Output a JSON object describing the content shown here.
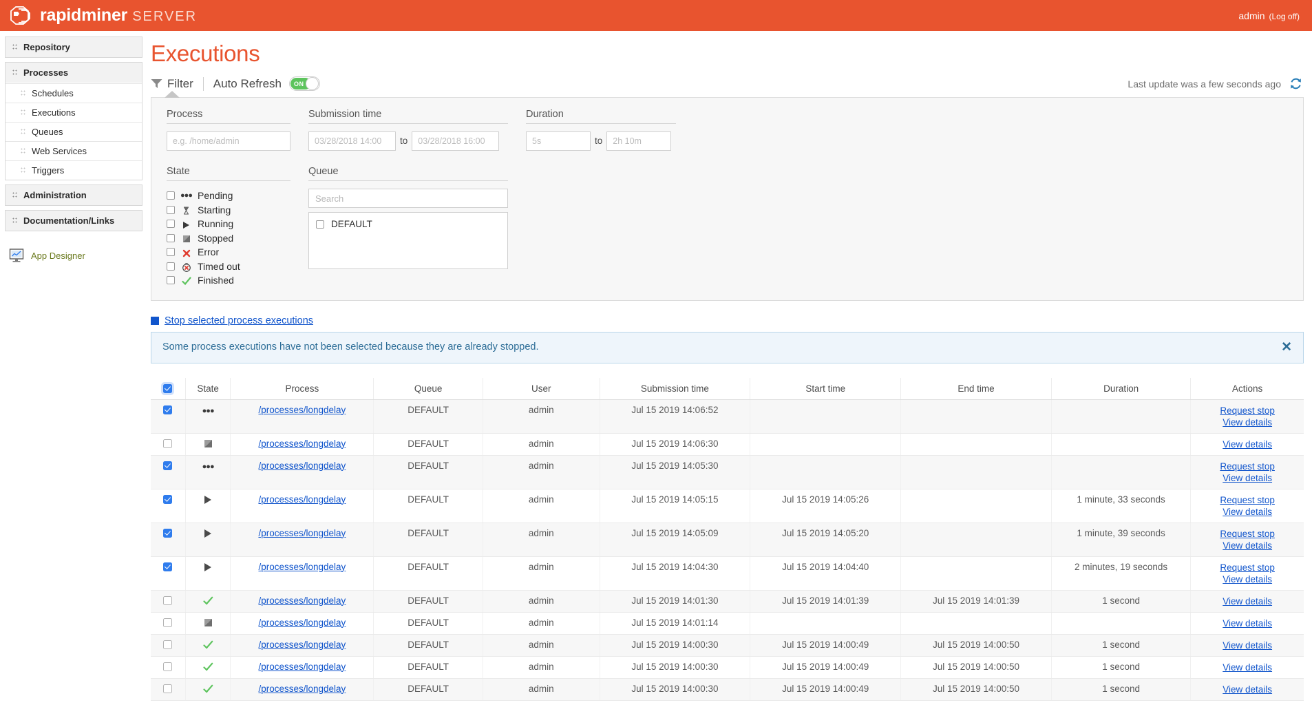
{
  "topbar": {
    "brand": "rapidminer",
    "brand_sub": "SERVER",
    "user": "admin",
    "logoff": "(Log off)",
    "bg_color": "#e8542f"
  },
  "sidebar": {
    "groups": [
      {
        "label": "Repository",
        "items": []
      },
      {
        "label": "Processes",
        "items": [
          "Schedules",
          "Executions",
          "Queues",
          "Web Services",
          "Triggers"
        ]
      },
      {
        "label": "Administration",
        "items": []
      },
      {
        "label": "Documentation/Links",
        "items": []
      }
    ],
    "app_designer": "App Designer"
  },
  "page": {
    "title": "Executions",
    "filter_label": "Filter",
    "auto_refresh_label": "Auto Refresh",
    "toggle_state": "ON",
    "last_update": "Last update was a few seconds ago"
  },
  "filter": {
    "process": {
      "label": "Process",
      "value": "",
      "placeholder": "e.g. /home/admin"
    },
    "submission": {
      "label": "Submission time",
      "from_value": "",
      "from_placeholder": "03/28/2018 14:00",
      "to_word": "to",
      "to_value": "",
      "to_placeholder": "03/28/2018 16:00"
    },
    "duration": {
      "label": "Duration",
      "from_value": "",
      "from_placeholder": "5s",
      "to_word": "to",
      "to_value": "",
      "to_placeholder": "2h 10m"
    },
    "state": {
      "label": "State",
      "options": [
        {
          "label": "Pending",
          "icon": "pending-icon",
          "checked": false
        },
        {
          "label": "Starting",
          "icon": "hourglass-icon",
          "checked": false
        },
        {
          "label": "Running",
          "icon": "play-icon",
          "checked": false
        },
        {
          "label": "Stopped",
          "icon": "stop-icon",
          "checked": false
        },
        {
          "label": "Error",
          "icon": "x-error-icon",
          "checked": false
        },
        {
          "label": "Timed out",
          "icon": "timeout-icon",
          "checked": false
        },
        {
          "label": "Finished",
          "icon": "check-icon",
          "checked": false
        }
      ]
    },
    "queue": {
      "label": "Queue",
      "search_value": "",
      "search_placeholder": "Search",
      "items": [
        {
          "label": "DEFAULT",
          "checked": false
        }
      ]
    }
  },
  "actions": {
    "stop_selected": "Stop selected process executions"
  },
  "alert": {
    "message": "Some process executions have not been selected because they are already stopped.",
    "close": "✕",
    "text_color": "#2b6c96",
    "bg_color": "#eef5fb"
  },
  "table": {
    "headers": [
      "",
      "State",
      "Process",
      "Queue",
      "User",
      "Submission time",
      "Start time",
      "End time",
      "Duration",
      "Actions"
    ],
    "header_checkbox_checked": true,
    "rows": [
      {
        "checked": true,
        "state": "pending",
        "process": "/processes/longdelay",
        "queue": "DEFAULT",
        "user": "admin",
        "submission": "Jul 15 2019 14:06:52",
        "start": "",
        "end": "",
        "duration": "",
        "actions": [
          "Request stop",
          "View details"
        ]
      },
      {
        "checked": false,
        "state": "stopped",
        "process": "/processes/longdelay",
        "queue": "DEFAULT",
        "user": "admin",
        "submission": "Jul 15 2019 14:06:30",
        "start": "",
        "end": "",
        "duration": "",
        "actions": [
          "View details"
        ]
      },
      {
        "checked": true,
        "state": "pending",
        "process": "/processes/longdelay",
        "queue": "DEFAULT",
        "user": "admin",
        "submission": "Jul 15 2019 14:05:30",
        "start": "",
        "end": "",
        "duration": "",
        "actions": [
          "Request stop",
          "View details"
        ]
      },
      {
        "checked": true,
        "state": "running",
        "process": "/processes/longdelay",
        "queue": "DEFAULT",
        "user": "admin",
        "submission": "Jul 15 2019 14:05:15",
        "start": "Jul 15 2019 14:05:26",
        "end": "",
        "duration": "1 minute, 33 seconds",
        "actions": [
          "Request stop",
          "View details"
        ]
      },
      {
        "checked": true,
        "state": "running",
        "process": "/processes/longdelay",
        "queue": "DEFAULT",
        "user": "admin",
        "submission": "Jul 15 2019 14:05:09",
        "start": "Jul 15 2019 14:05:20",
        "end": "",
        "duration": "1 minute, 39 seconds",
        "actions": [
          "Request stop",
          "View details"
        ]
      },
      {
        "checked": true,
        "state": "running",
        "process": "/processes/longdelay",
        "queue": "DEFAULT",
        "user": "admin",
        "submission": "Jul 15 2019 14:04:30",
        "start": "Jul 15 2019 14:04:40",
        "end": "",
        "duration": "2 minutes, 19 seconds",
        "actions": [
          "Request stop",
          "View details"
        ]
      },
      {
        "checked": false,
        "state": "finished",
        "process": "/processes/longdelay",
        "queue": "DEFAULT",
        "user": "admin",
        "submission": "Jul 15 2019 14:01:30",
        "start": "Jul 15 2019 14:01:39",
        "end": "Jul 15 2019 14:01:39",
        "duration": "1 second",
        "actions": [
          "View details"
        ]
      },
      {
        "checked": false,
        "state": "stopped",
        "process": "/processes/longdelay",
        "queue": "DEFAULT",
        "user": "admin",
        "submission": "Jul 15 2019 14:01:14",
        "start": "",
        "end": "",
        "duration": "",
        "actions": [
          "View details"
        ]
      },
      {
        "checked": false,
        "state": "finished",
        "process": "/processes/longdelay",
        "queue": "DEFAULT",
        "user": "admin",
        "submission": "Jul 15 2019 14:00:30",
        "start": "Jul 15 2019 14:00:49",
        "end": "Jul 15 2019 14:00:50",
        "duration": "1 second",
        "actions": [
          "View details"
        ]
      },
      {
        "checked": false,
        "state": "finished",
        "process": "/processes/longdelay",
        "queue": "DEFAULT",
        "user": "admin",
        "submission": "Jul 15 2019 14:00:30",
        "start": "Jul 15 2019 14:00:49",
        "end": "Jul 15 2019 14:00:50",
        "duration": "1 second",
        "actions": [
          "View details"
        ]
      },
      {
        "checked": false,
        "state": "finished",
        "process": "/processes/longdelay",
        "queue": "DEFAULT",
        "user": "admin",
        "submission": "Jul 15 2019 14:00:30",
        "start": "Jul 15 2019 14:00:49",
        "end": "Jul 15 2019 14:00:50",
        "duration": "1 second",
        "actions": [
          "View details"
        ]
      }
    ]
  }
}
